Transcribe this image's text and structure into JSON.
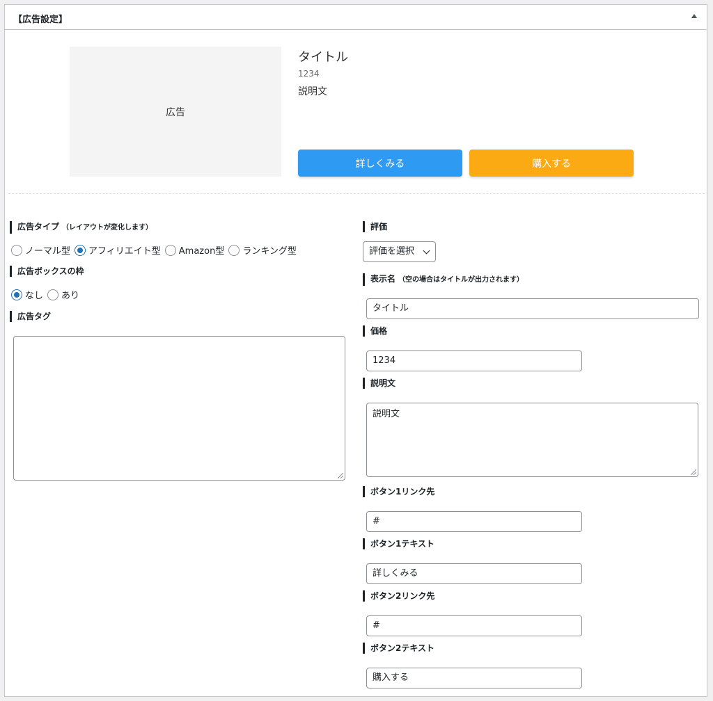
{
  "panel": {
    "title": "【広告設定】",
    "toggle_icon": "triangle-up-icon"
  },
  "preview": {
    "image_label": "広告",
    "title": "タイトル",
    "price": "1234",
    "description": "説明文",
    "button1": "詳しくみる",
    "button2": "購入する",
    "colors": {
      "button1": "#2f9af2",
      "button2": "#fcaa14"
    }
  },
  "form": {
    "ad_type": {
      "label": "広告タイプ",
      "hint": "（レイアウトが変化します）",
      "options": [
        "ノーマル型",
        "アフィリエイト型",
        "Amazon型",
        "ランキング型"
      ],
      "selected": "アフィリエイト型"
    },
    "frame": {
      "label": "広告ボックスの枠",
      "options": [
        "なし",
        "あり"
      ],
      "selected": "なし"
    },
    "tag": {
      "label": "広告タグ",
      "value": ""
    },
    "rating": {
      "label": "評価",
      "value": "評価を選択"
    },
    "display_name": {
      "label": "表示名",
      "hint": "（空の場合はタイトルが出力されます）",
      "value": "タイトル"
    },
    "price": {
      "label": "価格",
      "value": "1234"
    },
    "description": {
      "label": "説明文",
      "value": "説明文"
    },
    "button1_link": {
      "label": "ボタン1リンク先",
      "value": "#"
    },
    "button1_text": {
      "label": "ボタン1テキスト",
      "value": "詳しくみる"
    },
    "button2_link": {
      "label": "ボタン2リンク先",
      "value": "#"
    },
    "button2_text": {
      "label": "ボタン2テキスト",
      "value": "購入する"
    }
  },
  "accent_color": "#2271b1"
}
